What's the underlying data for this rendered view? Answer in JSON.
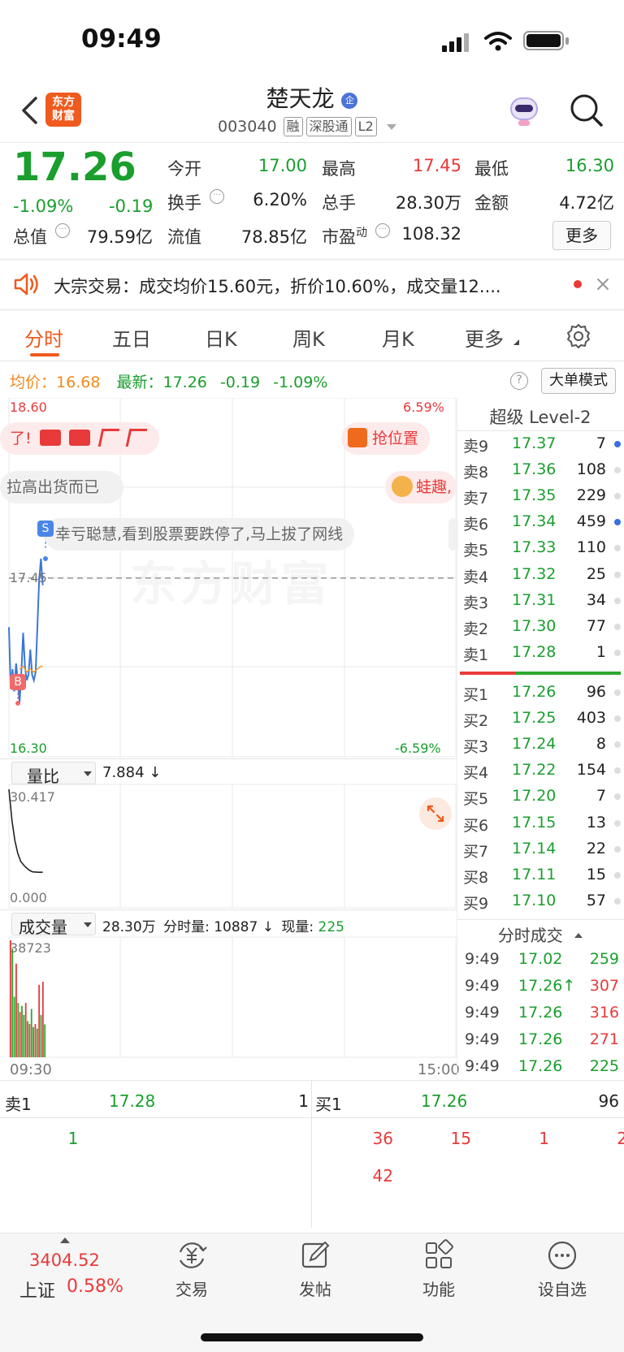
{
  "status_bar": {
    "time": "09:49"
  },
  "header": {
    "logo_text_line1": "东方",
    "logo_text_line2": "财富",
    "stock_name": "楚天龙",
    "stock_code": "003040",
    "tags": [
      "融",
      "深股通",
      "L2"
    ]
  },
  "quote": {
    "last_price": "17.26",
    "change_pct": "-1.09%",
    "change": "-0.19",
    "open_label": "今开",
    "open": "17.00",
    "high_label": "最高",
    "high": "17.45",
    "low_label": "最低",
    "low": "16.30",
    "turnover_label": "换手",
    "turnover": "6.20%",
    "volume_label": "总手",
    "volume": "28.30万",
    "amount_label": "金额",
    "amount": "4.72亿",
    "total_mv_label": "总值",
    "total_mv": "79.59亿",
    "float_mv_label": "流值",
    "float_mv": "78.85亿",
    "pe_label": "市盈",
    "pe_sup": "动",
    "pe": "108.32",
    "more_label": "更多"
  },
  "notice": {
    "text": "大宗交易：成交均价15.60元，折价10.60%，成交量12...."
  },
  "tabs": [
    "分时",
    "五日",
    "日K",
    "周K",
    "月K",
    "更多"
  ],
  "chart": {
    "avg_label": "均价：",
    "avg": "16.68",
    "latest_label": "最新：",
    "latest": "17.26",
    "latest_chg": "-0.19",
    "latest_pct": "-1.09%",
    "big_order_label": "大单模式",
    "y_top": "18.60",
    "y_top_pct": "6.59%",
    "y_bottom": "16.30",
    "y_bottom_pct": "-6.59%",
    "ref_price": "17.45",
    "watermark": "东方财富",
    "bubbles": [
      "了!",
      "抢位置",
      "拉高出货而已",
      "蛙趣,",
      "幸亏聪慧,看到股票要跌停了,马上拔了网线"
    ],
    "marker_s": "S",
    "marker_b": "B",
    "ratio_label": "量比",
    "ratio_value": "7.884 ↓",
    "ratio_top": "30.417",
    "ratio_bottom": "0.000",
    "vol_label": "成交量",
    "vol_total": "28.30万",
    "vol_minute_label": "分时量:",
    "vol_minute": "10887 ↓",
    "vol_now_label": "现量:",
    "vol_now": "225",
    "vol_top": "38723",
    "time_start": "09:30",
    "time_end": "15:00",
    "price_line": [
      [
        0,
        16.96
      ],
      [
        0.3,
        16.52
      ],
      [
        0.6,
        16.66
      ],
      [
        0.9,
        16.5
      ],
      [
        1.2,
        16.7
      ],
      [
        1.5,
        16.58
      ],
      [
        1.8,
        16.42
      ],
      [
        2.1,
        16.64
      ],
      [
        2.4,
        16.92
      ],
      [
        2.7,
        16.68
      ],
      [
        3.0,
        16.58
      ],
      [
        3.3,
        16.62
      ],
      [
        3.6,
        16.8
      ],
      [
        3.9,
        16.62
      ],
      [
        4.2,
        16.58
      ],
      [
        4.5,
        16.64
      ],
      [
        4.8,
        16.96
      ],
      [
        5.1,
        17.3
      ],
      [
        5.4,
        17.45
      ],
      [
        5.7,
        17.26
      ]
    ],
    "avg_line": [
      [
        1.8,
        16.66
      ],
      [
        2.4,
        16.68
      ],
      [
        3.0,
        16.64
      ],
      [
        3.6,
        16.66
      ],
      [
        4.2,
        16.64
      ],
      [
        4.8,
        16.66
      ],
      [
        5.4,
        16.68
      ],
      [
        5.7,
        16.68
      ]
    ],
    "ratio_line": [
      [
        0,
        30.4
      ],
      [
        0.5,
        22.0
      ],
      [
        1.0,
        16.5
      ],
      [
        1.5,
        13.0
      ],
      [
        2.0,
        10.8
      ],
      [
        2.5,
        9.8
      ],
      [
        3.0,
        9.0
      ],
      [
        3.5,
        8.4
      ],
      [
        4.0,
        8.0
      ],
      [
        5.0,
        7.9
      ],
      [
        5.7,
        7.88
      ]
    ],
    "volume_bars": [
      {
        "v": 38723,
        "c": "red"
      },
      {
        "v": 36000,
        "c": "green"
      },
      {
        "v": 20000,
        "c": "green"
      },
      {
        "v": 31000,
        "c": "red"
      },
      {
        "v": 18000,
        "c": "green"
      },
      {
        "v": 15000,
        "c": "red"
      },
      {
        "v": 17000,
        "c": "green"
      },
      {
        "v": 14000,
        "c": "green"
      },
      {
        "v": 18000,
        "c": "red"
      },
      {
        "v": 12000,
        "c": "green"
      },
      {
        "v": 11000,
        "c": "red"
      },
      {
        "v": 16000,
        "c": "green"
      },
      {
        "v": 10000,
        "c": "green"
      },
      {
        "v": 11000,
        "c": "red"
      },
      {
        "v": 9500,
        "c": "green"
      },
      {
        "v": 24000,
        "c": "red"
      },
      {
        "v": 14000,
        "c": "green"
      },
      {
        "v": 25000,
        "c": "red"
      },
      {
        "v": 10887,
        "c": "green"
      }
    ]
  },
  "level2": {
    "title": "超级 Level-2",
    "asks": [
      {
        "label": "卖9",
        "price": "17.37",
        "vol": "7",
        "dot": "blue"
      },
      {
        "label": "卖8",
        "price": "17.36",
        "vol": "108",
        "dot": "gray"
      },
      {
        "label": "卖7",
        "price": "17.35",
        "vol": "229",
        "dot": "gray"
      },
      {
        "label": "卖6",
        "price": "17.34",
        "vol": "459",
        "dot": "blue"
      },
      {
        "label": "卖5",
        "price": "17.33",
        "vol": "110",
        "dot": "gray"
      },
      {
        "label": "卖4",
        "price": "17.32",
        "vol": "25",
        "dot": "gray"
      },
      {
        "label": "卖3",
        "price": "17.31",
        "vol": "34",
        "dot": "gray"
      },
      {
        "label": "卖2",
        "price": "17.30",
        "vol": "77",
        "dot": "gray"
      },
      {
        "label": "卖1",
        "price": "17.28",
        "vol": "1",
        "dot": "gray"
      }
    ],
    "bids": [
      {
        "label": "买1",
        "price": "17.26",
        "vol": "96",
        "dot": "gray"
      },
      {
        "label": "买2",
        "price": "17.25",
        "vol": "403",
        "dot": "gray"
      },
      {
        "label": "买3",
        "price": "17.24",
        "vol": "8",
        "dot": "gray"
      },
      {
        "label": "买4",
        "price": "17.22",
        "vol": "154",
        "dot": "gray"
      },
      {
        "label": "买5",
        "price": "17.20",
        "vol": "7",
        "dot": "gray"
      },
      {
        "label": "买6",
        "price": "17.15",
        "vol": "13",
        "dot": "gray"
      },
      {
        "label": "买7",
        "price": "17.14",
        "vol": "22",
        "dot": "gray"
      },
      {
        "label": "买8",
        "price": "17.11",
        "vol": "15",
        "dot": "gray"
      },
      {
        "label": "买9",
        "price": "17.10",
        "vol": "57",
        "dot": "gray"
      }
    ],
    "ticks_title": "分时成交",
    "ticks": [
      {
        "time": "9:49",
        "price": "17.02",
        "vol": "259",
        "vc": "green"
      },
      {
        "time": "9:49",
        "price": "17.26↑",
        "vol": "307",
        "vc": "red"
      },
      {
        "time": "9:49",
        "price": "17.26",
        "vol": "316",
        "vc": "red"
      },
      {
        "time": "9:49",
        "price": "17.26",
        "vol": "271",
        "vc": "red"
      },
      {
        "time": "9:49",
        "price": "17.26",
        "vol": "225",
        "vc": "green"
      }
    ]
  },
  "queue": {
    "ask_label": "卖1",
    "ask_price": "17.28",
    "ask_vol": "1",
    "bid_label": "买1",
    "bid_price": "17.26",
    "bid_vol": "96",
    "ask_orders": [
      "1"
    ],
    "bid_orders": [
      "36",
      "15",
      "1",
      "2",
      "42"
    ]
  },
  "bottom_nav": {
    "index_value": "3404.52",
    "index_name": "上证",
    "index_pct": "0.58%",
    "items": [
      "交易",
      "发帖",
      "功能",
      "设自选"
    ]
  }
}
